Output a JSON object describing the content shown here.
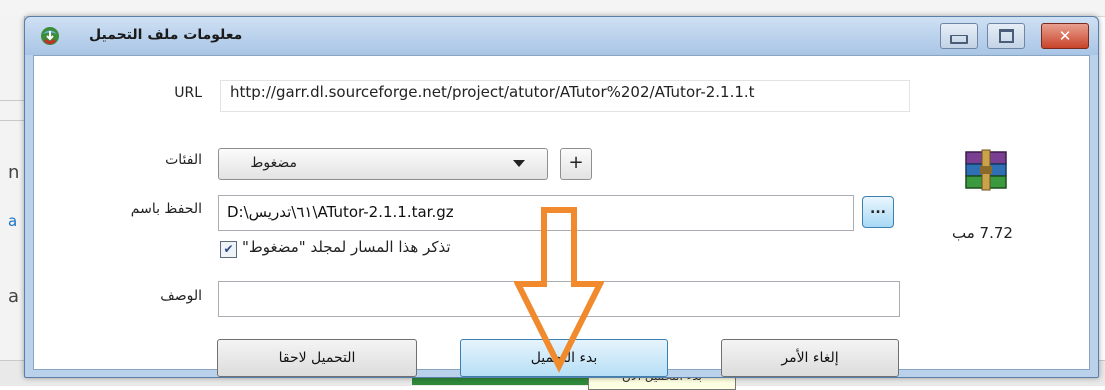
{
  "window": {
    "title": "معلومات ملف التحميل",
    "close_glyph": "✕"
  },
  "url": {
    "label": "URL",
    "value": "http://garr.dl.sourceforge.net/project/atutor/ATutor%202/ATutor-2.1.1.t"
  },
  "category": {
    "label": "الفئات",
    "selected": "مضغوط",
    "add_label": "+"
  },
  "save_as": {
    "label": "الحفظ باسم",
    "value": "D:\\٦١\\تدريس\\ATutor-2.1.1.tar.gz",
    "browse_label": "..."
  },
  "remember": {
    "checked": true,
    "label": "تذكر هذا المسار لمجلد \"مضغوط\""
  },
  "description": {
    "label": "الوصف",
    "value": ""
  },
  "buttons": {
    "download_later": "التحميل لاحقا",
    "start_download": "بدء التحميل",
    "cancel": "إلغاء الأمر"
  },
  "file": {
    "size": "7.72  مب",
    "icon": "winrar-archive-icon"
  },
  "background": {
    "left_letters": [
      "n",
      "a",
      "a"
    ],
    "tooltip": "بدء التحميل الآن"
  },
  "colors": {
    "titlebar": "#b9d1ea",
    "annotation_arrow": "#f08a2c",
    "close_button": "#c8432a"
  }
}
